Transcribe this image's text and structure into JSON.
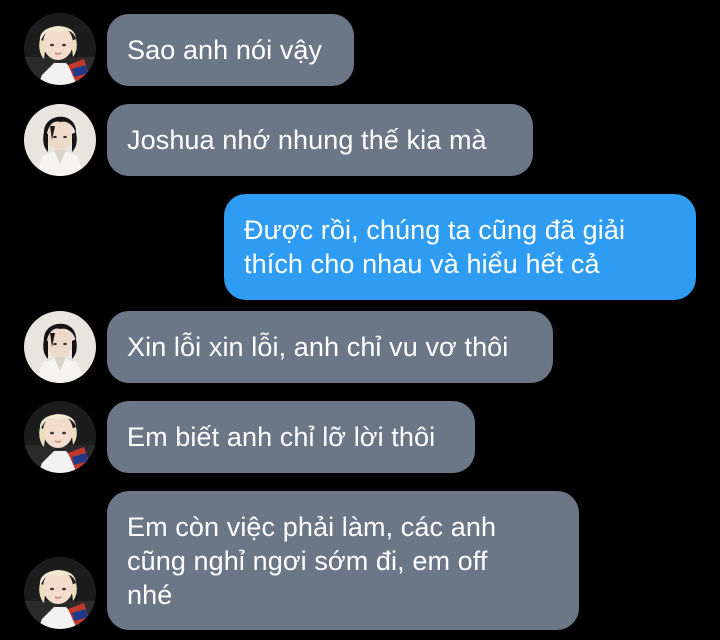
{
  "colors": {
    "background": "#000000",
    "incoming_bubble": "#6b7787",
    "outgoing_bubble": "#2f9cf3",
    "text": "#ffffff"
  },
  "messages": [
    {
      "direction": "incoming",
      "avatar": "blonde-person-avatar",
      "text": "Sao anh nói vậy"
    },
    {
      "direction": "incoming",
      "avatar": "dark-haired-person-avatar",
      "text": "Joshua nhớ nhung thế kia mà"
    },
    {
      "direction": "outgoing",
      "text": "Được rồi, chúng ta cũng đã giải\nthích cho nhau và hiểu hết cả"
    },
    {
      "direction": "incoming",
      "avatar": "dark-haired-person-avatar",
      "text": "Xin lỗi xin lỗi, anh chỉ vu vơ thôi"
    },
    {
      "direction": "incoming",
      "avatar": "blonde-person-avatar",
      "text": "Em biết anh chỉ lỡ lời thôi"
    },
    {
      "direction": "incoming",
      "avatar": "blonde-person-avatar",
      "text": "Em còn việc phải làm, các anh\ncũng nghỉ ngơi sớm đi, em off\nnhé"
    }
  ]
}
